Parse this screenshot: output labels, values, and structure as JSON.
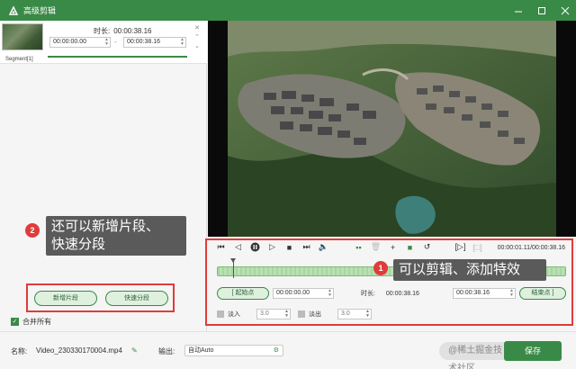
{
  "window": {
    "title": "高级剪辑"
  },
  "segment": {
    "label": "Segment[1]",
    "duration_label": "时长:",
    "duration": "00:00:38.16",
    "start": "00:00:00.00",
    "end": "00:00:38.16",
    "separator": "-"
  },
  "callout_left": {
    "number": "2",
    "line1": "还可以新增片段、",
    "line2": "快速分段"
  },
  "callout_right": {
    "number": "1",
    "text": "可以剪辑、添加特效"
  },
  "left_buttons": {
    "new_segment": "新增片段",
    "quick_split": "快速分段"
  },
  "merge_all": {
    "label": "合并所有",
    "checked": true
  },
  "player": {
    "time": "00:00:01.11/00:00:38.16",
    "progress_fraction": 0.03
  },
  "range": {
    "start_label": "起始点",
    "start_time": "00:00:00.00",
    "duration_label": "时长:",
    "duration": "00:00:38.16",
    "end_time": "00:00:38.16",
    "end_label": "结束点"
  },
  "fade": {
    "in_label": "淡入",
    "in_value": "3.0",
    "out_label": "淡出",
    "out_value": "3.0"
  },
  "bottom": {
    "name_label": "名称:",
    "filename": "Video_230330170004.mp4",
    "output_label": "输出:",
    "output_value": "自动Auto",
    "save_label": "保存",
    "watermark": "@稀土掘金技术社区"
  },
  "colors": {
    "accent": "#3a8a47",
    "callout_badge": "#e03b3b",
    "callout_bg": "#5a5a5a"
  }
}
